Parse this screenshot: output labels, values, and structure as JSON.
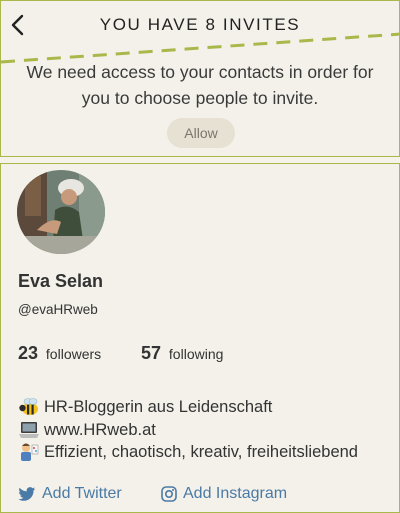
{
  "invite": {
    "title": "YOU HAVE 8 INVITES",
    "message": "We need access to your contacts in order for you to choose people to invite.",
    "allow_label": "Allow"
  },
  "profile": {
    "name": "Eva Selan",
    "handle": "@evaHRweb",
    "followers_count": "23",
    "followers_label": "followers",
    "following_count": "57",
    "following_label": "following",
    "bio": [
      {
        "icon": "bee-emoji-icon",
        "text": "HR-Bloggerin aus Leidenschaft"
      },
      {
        "icon": "laptop-emoji-icon",
        "text": "www.HRweb.at"
      },
      {
        "icon": "artist-emoji-icon",
        "text": "Effizient, chaotisch, kreativ, freiheitsliebend"
      }
    ],
    "add_twitter_label": "Add Twitter",
    "add_instagram_label": "Add Instagram"
  },
  "colors": {
    "accent_border": "#a9b84b",
    "link_blue": "#4a7aa6",
    "background": "#f3f1e9"
  }
}
